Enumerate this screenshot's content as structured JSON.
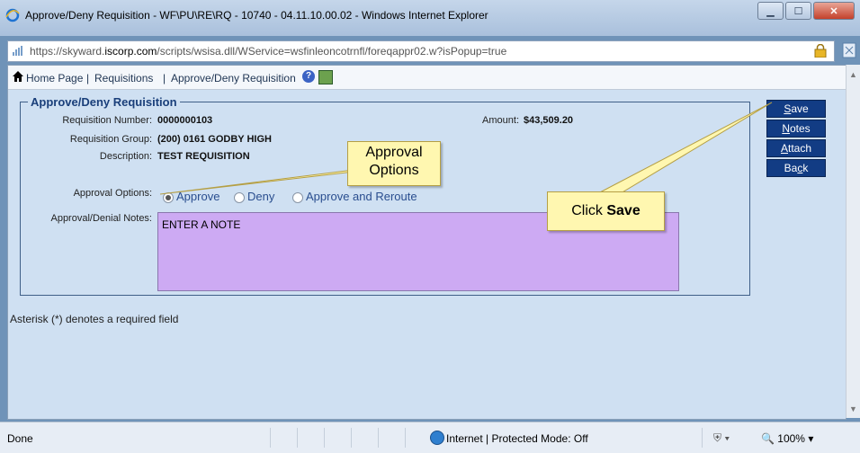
{
  "window": {
    "title": "Approve/Deny Requisition - WF\\PU\\RE\\RQ - 10740 - 04.11.10.00.02 - Windows Internet Explorer",
    "minimize": "▁",
    "maximize": "☐",
    "close": "✕"
  },
  "address": {
    "prefix": "https://skyward.",
    "domain": "iscorp.com",
    "rest": "/scripts/wsisa.dll/WService=wsfinleoncotrnfl/foreqappr02.w?isPopup=true"
  },
  "breadcrumb": {
    "home": "Home Page",
    "sep": "|",
    "requisitions": "Requisitions",
    "current": "Approve/Deny Requisition",
    "help": "?"
  },
  "form": {
    "legend": "Approve/Deny Requisition",
    "req_number_label": "Requisition Number:",
    "req_number": "0000000103",
    "amount_label": "Amount:",
    "amount": "$43,509.20",
    "req_group_label": "Requisition Group:",
    "req_group": "(200) 0161 GODBY HIGH",
    "description_label": "Description:",
    "description": "TEST REQUISITION",
    "approval_options_label": "Approval Options:",
    "options": [
      "Approve",
      "Deny",
      "Approve and Reroute"
    ],
    "selected_option": "Approve",
    "notes_label": "Approval/Denial Notes:",
    "notes_value": "ENTER A NOTE"
  },
  "buttons": {
    "save": {
      "u": "S",
      "rest": "ave"
    },
    "notes": {
      "u": "N",
      "rest": "otes"
    },
    "attach": {
      "u": "A",
      "rest": "ttach"
    },
    "back": {
      "pre": "Ba",
      "u": "c",
      "rest": "k"
    }
  },
  "footer_note": "Asterisk (*) denotes a required field",
  "callouts": {
    "approval_line1": "Approval",
    "approval_line2": "Options",
    "click_pre": "Click ",
    "click_bold": "Save"
  },
  "status": {
    "left": "Done",
    "zone": "Internet | Protected Mode: Off",
    "zoom": "100%"
  },
  "colors": {
    "button_bg": "#123c84",
    "notes_bg": "#cdaaf3",
    "callout_bg": "#fff7b0",
    "panel_bg": "#cfe0f2"
  },
  "icons": [
    "ie-icon",
    "https-icon",
    "lock-icon",
    "home-icon",
    "help-icon",
    "tool-icon",
    "globe-icon"
  ]
}
